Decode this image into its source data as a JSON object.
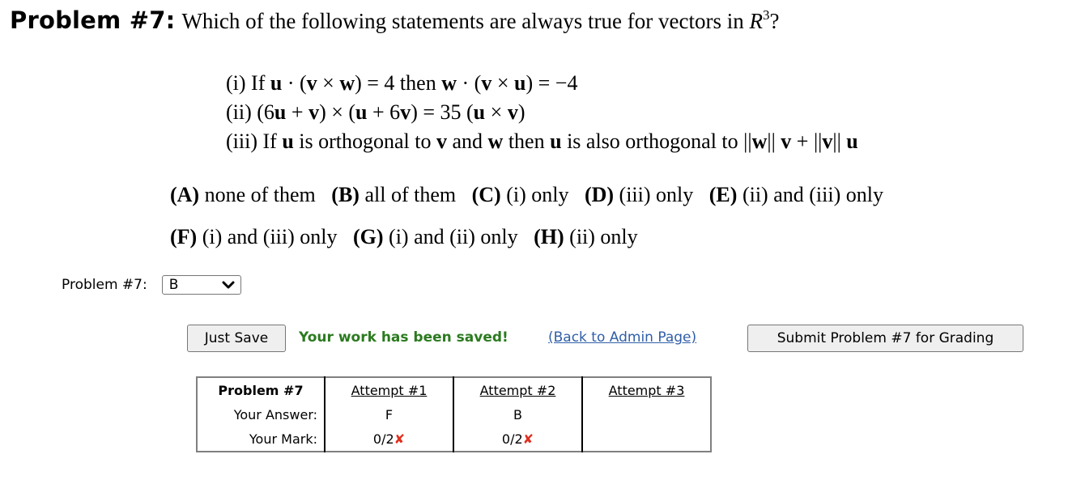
{
  "problem": {
    "label": "Problem #7:",
    "question_prefix": "Which of the following statements are always true for vectors in",
    "question_space": "R",
    "question_exponent": "3",
    "question_suffix": "?"
  },
  "statements": [
    {
      "id": "i",
      "text": "(i) If u · (v × w) = 4 then w · (v × u) = −4"
    },
    {
      "id": "ii",
      "text": "(ii) (6u + v) × (u + 6v) = 35 (u × v)"
    },
    {
      "id": "iii",
      "text": "(iii) If u is orthogonal to v and w then u is also orthogonal to ||w|| v + ||v|| u"
    }
  ],
  "choices": [
    {
      "letter": "(A)",
      "text": "none of them"
    },
    {
      "letter": "(B)",
      "text": "all of them"
    },
    {
      "letter": "(C)",
      "text": "(i) only"
    },
    {
      "letter": "(D)",
      "text": "(iii) only"
    },
    {
      "letter": "(E)",
      "text": "(ii) and (iii) only"
    },
    {
      "letter": "(F)",
      "text": "(i) and (iii) only"
    },
    {
      "letter": "(G)",
      "text": "(i) and (ii) only"
    },
    {
      "letter": "(H)",
      "text": "(ii) only"
    }
  ],
  "answer": {
    "label": "Problem #7:",
    "selected": "B"
  },
  "actions": {
    "just_save": "Just Save",
    "saved_message": "Your work has been saved!",
    "back_link": "(Back to Admin Page)",
    "submit": "Submit Problem #7 for Grading"
  },
  "attempts": {
    "title": "Problem #7",
    "headers": [
      "Attempt #1",
      "Attempt #2",
      "Attempt #3"
    ],
    "answer_label": "Your Answer:",
    "mark_label": "Your Mark:",
    "answers": [
      "F",
      "B",
      ""
    ],
    "marks": [
      "0/2",
      "0/2",
      ""
    ],
    "incorrect_icon": "✘"
  },
  "colors": {
    "saved_green": "#2b7a1f",
    "link_blue": "#2f5ea8",
    "incorrect_red": "#e03020"
  }
}
